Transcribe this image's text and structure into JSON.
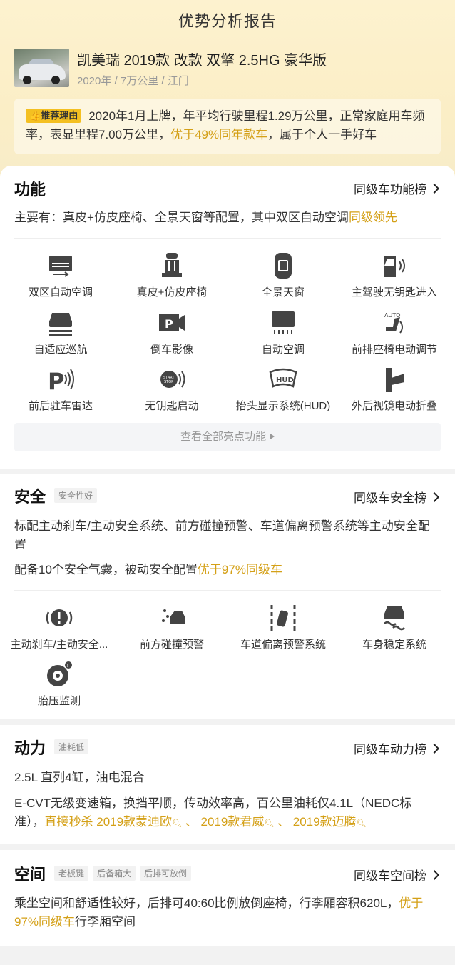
{
  "header": {
    "title": "优势分析报告"
  },
  "car": {
    "name": "凯美瑞 2019款 改款 双擎 2.5HG 豪华版",
    "meta": "2020年 / 7万公里 / 江门"
  },
  "reason": {
    "badge": "推荐理由",
    "text_before": "2020年1月上牌，年平均行驶里程1.29万公里，正常家庭用车频率，表显里程7.00万公里，",
    "highlight": "优于49%同年款车",
    "text_after": "，属于个人一手好车"
  },
  "function_section": {
    "title": "功能",
    "rank_link": "同级车功能榜",
    "summary_before": "主要有：真皮+仿皮座椅、全景天窗等配置，其中双区自动空调",
    "summary_highlight": "同级领先",
    "features": [
      {
        "label": "双区自动空调",
        "icon": "dual-zone-ac-icon"
      },
      {
        "label": "真皮+仿皮座椅",
        "icon": "leather-seat-icon"
      },
      {
        "label": "全景天窗",
        "icon": "panoramic-sunroof-icon"
      },
      {
        "label": "主驾驶无钥匙进入",
        "icon": "keyless-entry-icon"
      },
      {
        "label": "自适应巡航",
        "icon": "adaptive-cruise-icon"
      },
      {
        "label": "倒车影像",
        "icon": "reverse-camera-icon"
      },
      {
        "label": "自动空调",
        "icon": "auto-ac-icon"
      },
      {
        "label": "前排座椅电动调节",
        "icon": "power-seat-icon"
      },
      {
        "label": "前后驻车雷达",
        "icon": "parking-radar-icon"
      },
      {
        "label": "无钥匙启动",
        "icon": "keyless-start-icon"
      },
      {
        "label": "抬头显示系统(HUD)",
        "icon": "hud-icon"
      },
      {
        "label": "外后视镜电动折叠",
        "icon": "mirror-fold-icon"
      }
    ],
    "see_all": "查看全部亮点功能"
  },
  "safety_section": {
    "title": "安全",
    "tag": "安全性好",
    "rank_link": "同级车安全榜",
    "para1": "标配主动刹车/主动安全系统、前方碰撞预警、车道偏离预警系统等主动安全配置",
    "para2_before": "配备10个安全气囊，被动安全配置",
    "para2_highlight": "优于97%同级车",
    "features": [
      {
        "label": "主动刹车/主动安全...",
        "icon": "active-brake-icon"
      },
      {
        "label": "前方碰撞预警",
        "icon": "collision-warning-icon"
      },
      {
        "label": "车道偏离预警系统",
        "icon": "lane-departure-icon"
      },
      {
        "label": "车身稳定系统",
        "icon": "stability-control-icon"
      },
      {
        "label": "胎压监测",
        "icon": "tire-pressure-icon"
      }
    ]
  },
  "power_section": {
    "title": "动力",
    "tag": "油耗低",
    "rank_link": "同级车动力榜",
    "para1": "2.5L 直列4缸，油电混合",
    "para2": "E-CVT无级变速箱，换挡平顺，传动效率高，百公里油耗仅4.1L（NEDC标准），",
    "para2_highlight": "直接秒杀",
    "competitors": [
      "2019款蒙迪欧",
      "2019款君威",
      "2019款迈腾"
    ],
    "separator": "、"
  },
  "space_section": {
    "title": "空间",
    "tags": [
      "老板键",
      "后备箱大",
      "后排可放倒"
    ],
    "rank_link": "同级车空间榜",
    "para_before": "乘坐空间和舒适性较好，后排可40:60比例放倒座椅，行李厢容积620L，",
    "para_highlight": "优于97%同级车",
    "para_after": "行李厢空间"
  },
  "colors": {
    "accent_gold": "#d4a017",
    "badge_yellow": "#f4c021",
    "hero_bg": "#fdf2cf"
  }
}
